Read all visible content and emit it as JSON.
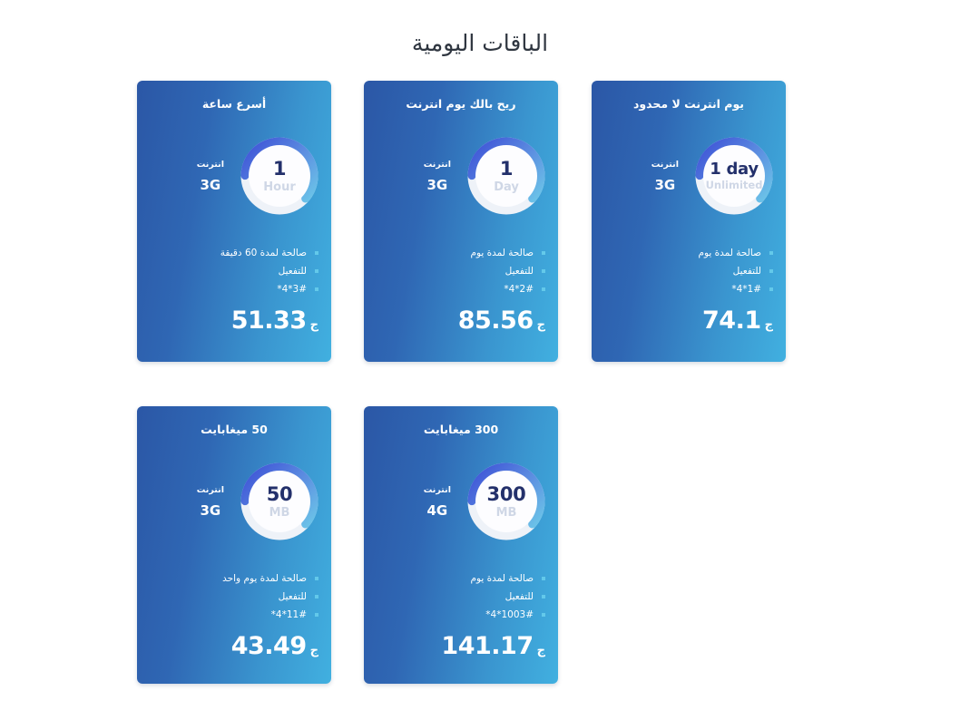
{
  "page": {
    "title": "الباقات اليومية"
  },
  "labels": {
    "speed_label": "انترنت",
    "currency": "ج"
  },
  "colors": {
    "card_gradient_start": "#2b57a6",
    "card_gradient_end": "#41b0e0",
    "gauge_track": "#eef2f8",
    "gauge_arc_dark": "#3c4fd6",
    "gauge_arc_mid": "#5b8be0",
    "gauge_arc_light": "#6fd0ea",
    "bullet": "#63c9ea",
    "gauge_value_text": "#23306b",
    "gauge_unit_text": "#cfd7e6",
    "title_text": "#2f3640"
  },
  "cards": [
    {
      "title": "يوم انترنت لا محدود",
      "gauge_value": "1 day",
      "gauge_unit": "Unlimited",
      "speed_label": "انترنت",
      "speed_value": "3G",
      "features": [
        "صالحة لمدة يوم",
        "للتفعيل",
        "*4*1#"
      ],
      "price": "74.1",
      "currency": "ج"
    },
    {
      "title": "ريح بالك يوم انترنت",
      "gauge_value": "1",
      "gauge_unit": "Day",
      "speed_label": "انترنت",
      "speed_value": "3G",
      "features": [
        "صالحة لمدة يوم",
        "للتفعيل",
        "*4*2#"
      ],
      "price": "85.56",
      "currency": "ج"
    },
    {
      "title": "أسرع ساعة",
      "gauge_value": "1",
      "gauge_unit": "Hour",
      "speed_label": "انترنت",
      "speed_value": "3G",
      "features": [
        "صالحة لمدة 60 دقيقة",
        "للتفعيل",
        "*4*3#"
      ],
      "price": "51.33",
      "currency": "ج"
    },
    {
      "title": "300 ميغابايت",
      "gauge_value": "300",
      "gauge_unit": "MB",
      "speed_label": "انترنت",
      "speed_value": "4G",
      "features": [
        "صالحة لمدة يوم",
        "للتفعيل",
        "*4*1003#"
      ],
      "price": "141.17",
      "currency": "ج"
    },
    {
      "title": "50 ميغابايت",
      "gauge_value": "50",
      "gauge_unit": "MB",
      "speed_label": "انترنت",
      "speed_value": "3G",
      "features": [
        "صالحة لمدة يوم واحد",
        "للتفعيل",
        "*4*11#"
      ],
      "price": "43.49",
      "currency": "ج"
    }
  ]
}
